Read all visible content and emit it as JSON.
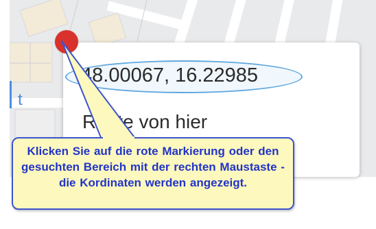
{
  "map": {
    "partial_label": "t"
  },
  "popup": {
    "coordinates": "48.00067, 16.22985",
    "route_label": "Route von hier"
  },
  "callout": {
    "text": "Klicken Sie auf die rote Markierung oder den gesuchten Bereich mit der rechten Maustaste - die Kordinaten werden angezeigt."
  },
  "colors": {
    "marker": "#d9312b",
    "callout_background": "#fdf8bd",
    "callout_border": "#3d53cf",
    "callout_text": "#2234c8",
    "highlight_border": "#5fa8de"
  },
  "icons": {
    "marker": "map-pin-icon"
  }
}
